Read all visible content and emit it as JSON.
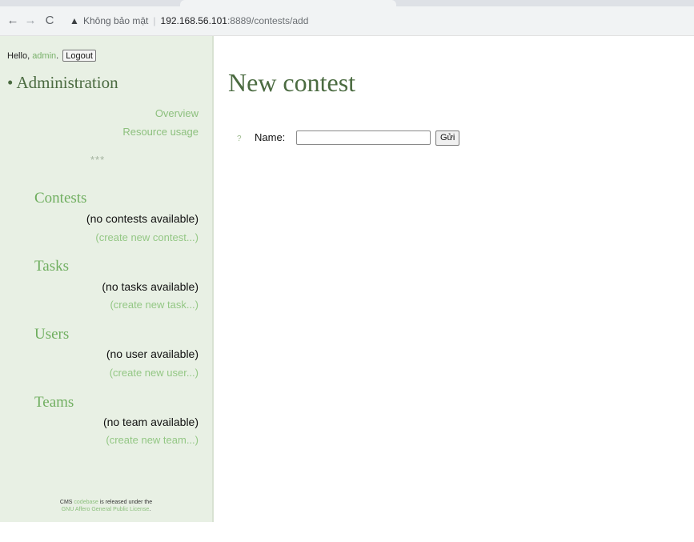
{
  "browser": {
    "back_icon": "←",
    "forward_icon": "→",
    "reload_icon": "C",
    "warning_icon": "▲",
    "security_label": "Không bảo mật",
    "separator": "|",
    "url_host": "192.168.56.101",
    "url_path": ":8889/contests/add"
  },
  "sidebar": {
    "hello_prefix": "Hello, ",
    "username": "admin",
    "hello_suffix": ".",
    "logout_label": "Logout",
    "admin_heading": "• Administration",
    "overview_label": "Overview",
    "resource_usage_label": "Resource usage",
    "stars": "***",
    "contests": {
      "title": "Contests",
      "note": "(no contests available)",
      "link": "(create new contest...)"
    },
    "tasks": {
      "title": "Tasks",
      "note": "(no tasks available)",
      "link": "(create new task...)"
    },
    "users": {
      "title": "Users",
      "note": "(no user available)",
      "link": "(create new user...)"
    },
    "teams": {
      "title": "Teams",
      "note": "(no team available)",
      "link": "(create new team...)"
    },
    "footer": {
      "line1_prefix": "CMS ",
      "line1_link": "codebase",
      "line1_suffix": " is released under the",
      "line2_link": "GNU Affero General Public License",
      "line2_suffix": "."
    }
  },
  "main": {
    "title": "New contest",
    "help_icon": "?",
    "name_label": "Name:",
    "name_value": "",
    "submit_label": "Gửi"
  }
}
